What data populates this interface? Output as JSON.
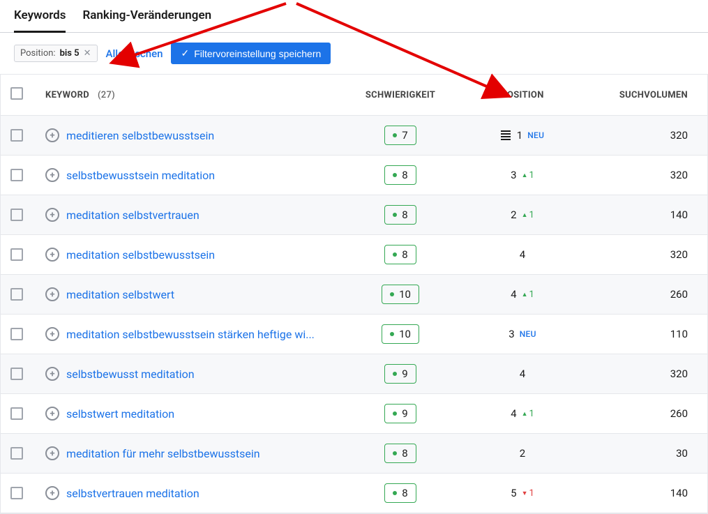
{
  "tabs": {
    "keywords": "Keywords",
    "ranking_changes": "Ranking-Veränderungen"
  },
  "filter": {
    "chip_label": "Position:",
    "chip_value": "bis 5",
    "clear_all": "Alle löschen",
    "save_preset": "Filtervoreinstellung speichern"
  },
  "columns": {
    "keyword": "KEYWORD",
    "keyword_count": "(27)",
    "difficulty": "SCHWIERIGKEIT",
    "position": "POSITION",
    "volume": "SUCHVOLUMEN"
  },
  "labels": {
    "new": "NEU"
  },
  "rows": [
    {
      "keyword": "meditieren selbstbewusstsein",
      "difficulty": 7,
      "position": 1,
      "serp_feature": true,
      "new": true,
      "delta": null,
      "delta_dir": null,
      "volume": 320
    },
    {
      "keyword": "selbstbewusstsein meditation",
      "difficulty": 8,
      "position": 3,
      "serp_feature": false,
      "new": false,
      "delta": 1,
      "delta_dir": "up",
      "volume": 320
    },
    {
      "keyword": "meditation selbstvertrauen",
      "difficulty": 8,
      "position": 2,
      "serp_feature": false,
      "new": false,
      "delta": 1,
      "delta_dir": "up",
      "volume": 140
    },
    {
      "keyword": "meditation selbstbewusstsein",
      "difficulty": 8,
      "position": 4,
      "serp_feature": false,
      "new": false,
      "delta": null,
      "delta_dir": null,
      "volume": 320
    },
    {
      "keyword": "meditation selbstwert",
      "difficulty": 10,
      "position": 4,
      "serp_feature": false,
      "new": false,
      "delta": 1,
      "delta_dir": "up",
      "volume": 260
    },
    {
      "keyword": "meditation selbstbewusstsein stärken heftige wi...",
      "difficulty": 10,
      "position": 3,
      "serp_feature": false,
      "new": true,
      "delta": null,
      "delta_dir": null,
      "volume": 110
    },
    {
      "keyword": "selbstbewusst meditation",
      "difficulty": 9,
      "position": 4,
      "serp_feature": false,
      "new": false,
      "delta": null,
      "delta_dir": null,
      "volume": 320
    },
    {
      "keyword": "selbstwert meditation",
      "difficulty": 9,
      "position": 4,
      "serp_feature": false,
      "new": false,
      "delta": 1,
      "delta_dir": "up",
      "volume": 260
    },
    {
      "keyword": "meditation für mehr selbstbewusstsein",
      "difficulty": 8,
      "position": 2,
      "serp_feature": false,
      "new": false,
      "delta": null,
      "delta_dir": null,
      "volume": 30
    },
    {
      "keyword": "selbstvertrauen meditation",
      "difficulty": 8,
      "position": 5,
      "serp_feature": false,
      "new": false,
      "delta": 1,
      "delta_dir": "down",
      "volume": 140
    }
  ]
}
